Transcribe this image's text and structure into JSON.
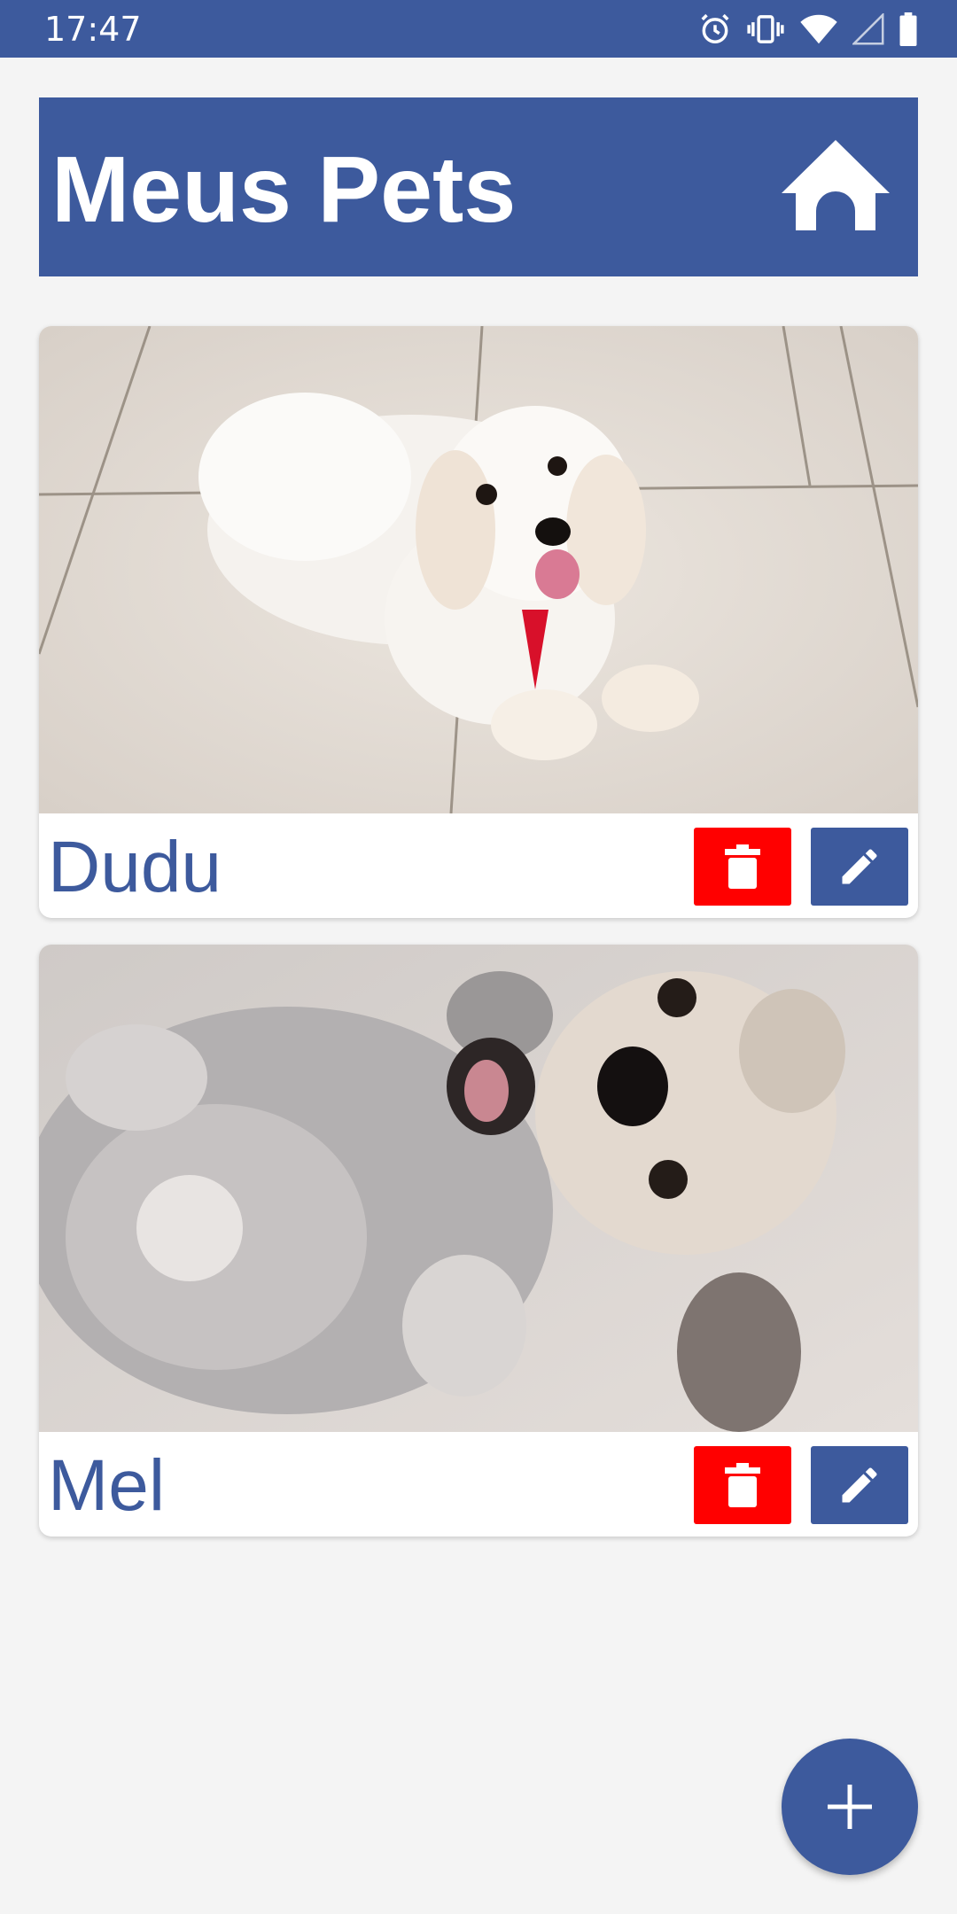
{
  "status_bar": {
    "time": "17:47",
    "icons": [
      "alarm-icon",
      "vibrate-icon",
      "wifi-icon",
      "signal-icon",
      "battery-icon"
    ]
  },
  "header": {
    "title": "Meus Pets",
    "home_icon": "home-icon"
  },
  "pets": [
    {
      "name": "Dudu",
      "photo": "white fluffy dog lying on tiled floor",
      "delete_icon": "trash-icon",
      "edit_icon": "pencil-icon"
    },
    {
      "name": "Mel",
      "photo": "light grey puppy lying on its back",
      "delete_icon": "trash-icon",
      "edit_icon": "pencil-icon"
    }
  ],
  "fab": {
    "icon": "plus-icon"
  },
  "colors": {
    "primary": "#3d5a9d",
    "delete": "#ff0000",
    "background": "#f4f4f4",
    "card": "#ffffff"
  }
}
